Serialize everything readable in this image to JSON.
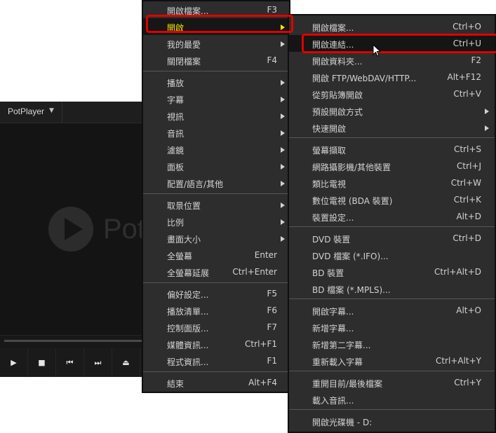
{
  "player": {
    "title": "PotPlayer",
    "logo_text": "Pot",
    "controls": [
      {
        "name": "play-icon",
        "glyph": "▶"
      },
      {
        "name": "stop-icon",
        "glyph": "■"
      },
      {
        "name": "previous-icon",
        "glyph": "⏮"
      },
      {
        "name": "next-icon",
        "glyph": "⏭"
      },
      {
        "name": "eject-icon",
        "glyph": "⏏"
      }
    ]
  },
  "menu1": {
    "items": [
      {
        "label": "開啟檔案...",
        "shortcut": "F3"
      },
      {
        "label": "開啟",
        "shortcut": "",
        "submenu": true,
        "selected": true
      },
      {
        "label": "我的最愛",
        "shortcut": "",
        "submenu": true
      },
      {
        "label": "關閉檔案",
        "shortcut": "F4"
      },
      {
        "label": "播放",
        "shortcut": "",
        "submenu": true
      },
      {
        "label": "字幕",
        "shortcut": "",
        "submenu": true
      },
      {
        "label": "視訊",
        "shortcut": "",
        "submenu": true
      },
      {
        "label": "音訊",
        "shortcut": "",
        "submenu": true
      },
      {
        "label": "濾鏡",
        "shortcut": "",
        "submenu": true
      },
      {
        "label": "面板",
        "shortcut": "",
        "submenu": true
      },
      {
        "label": "配置/語言/其他",
        "shortcut": "",
        "submenu": true
      },
      {
        "label": "取景位置",
        "shortcut": "",
        "submenu": true
      },
      {
        "label": "比例",
        "shortcut": "",
        "submenu": true
      },
      {
        "label": "畫面大小",
        "shortcut": "",
        "submenu": true
      },
      {
        "label": "全螢幕",
        "shortcut": "Enter"
      },
      {
        "label": "全螢幕延展",
        "shortcut": "Ctrl+Enter"
      },
      {
        "label": "偏好設定...",
        "shortcut": "F5"
      },
      {
        "label": "播放清單...",
        "shortcut": "F6"
      },
      {
        "label": "控制面版...",
        "shortcut": "F7"
      },
      {
        "label": "媒體資訊...",
        "shortcut": "Ctrl+F1"
      },
      {
        "label": "程式資訊...",
        "shortcut": "F1"
      },
      {
        "label": "結束",
        "shortcut": "Alt+F4"
      }
    ]
  },
  "menu2": {
    "items": [
      {
        "label": "開啟檔案...",
        "shortcut": "Ctrl+O"
      },
      {
        "label": "開啟連結...",
        "shortcut": "Ctrl+U",
        "highlighted": true
      },
      {
        "label": "開啟資料夾...",
        "shortcut": "F2"
      },
      {
        "label": "開啟 FTP/WebDAV/HTTP...",
        "shortcut": "Alt+F12"
      },
      {
        "label": "從剪貼簿開啟",
        "shortcut": "Ctrl+V"
      },
      {
        "label": "預設開啟方式",
        "shortcut": "",
        "submenu": true
      },
      {
        "label": "快速開啟",
        "shortcut": "",
        "submenu": true
      },
      {
        "label": "螢幕擷取",
        "shortcut": "Ctrl+S"
      },
      {
        "label": "網路攝影機/其他裝置",
        "shortcut": "Ctrl+J"
      },
      {
        "label": "類比電視",
        "shortcut": "Ctrl+W"
      },
      {
        "label": "數位電視 (BDA 裝置)",
        "shortcut": "Ctrl+K"
      },
      {
        "label": "裝置設定...",
        "shortcut": "Alt+D"
      },
      {
        "label": "DVD 裝置",
        "shortcut": "Ctrl+D"
      },
      {
        "label": "DVD 檔案 (*.IFO)...",
        "shortcut": ""
      },
      {
        "label": "BD 裝置",
        "shortcut": "Ctrl+Alt+D"
      },
      {
        "label": "BD 檔案 (*.MPLS)...",
        "shortcut": ""
      },
      {
        "label": "開啟字幕...",
        "shortcut": "Alt+O"
      },
      {
        "label": "新增字幕...",
        "shortcut": ""
      },
      {
        "label": "新增第二字幕...",
        "shortcut": ""
      },
      {
        "label": "重新載入字幕",
        "shortcut": "Ctrl+Alt+Y"
      },
      {
        "label": "重開目前/最後檔案",
        "shortcut": "Ctrl+Y"
      },
      {
        "label": "載入音訊...",
        "shortcut": ""
      },
      {
        "label": "開啟光碟機 - D:",
        "shortcut": ""
      }
    ]
  },
  "colors": {
    "menu_bg": "#2d2d2d",
    "selected_text": "#f2e400",
    "annotation_red": "#e00000"
  }
}
